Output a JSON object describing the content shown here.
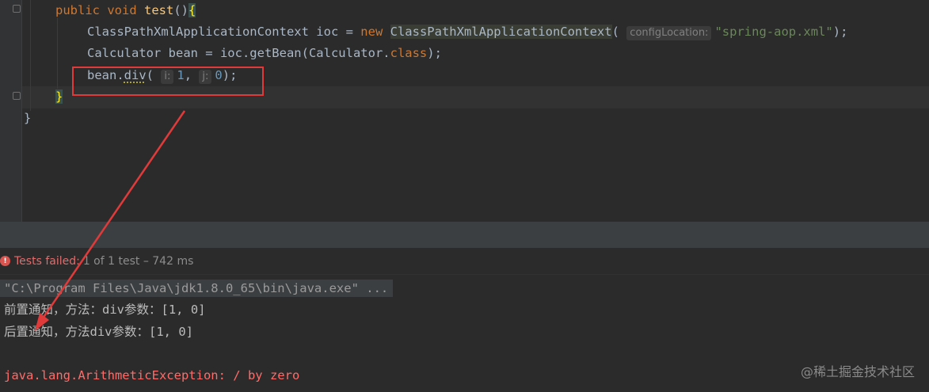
{
  "editor": {
    "line1": {
      "kw1": "public",
      "kw2": "void",
      "fn": "test",
      "rest": "()",
      "brace": "{"
    },
    "line2": {
      "type": "ClassPathXmlApplicationContext",
      "var": " ioc = ",
      "kw": "new",
      "cls": "ClassPathXmlApplicationContext",
      "open": "(",
      "hint": "configLocation:",
      "str": "\"spring-aop.xml\"",
      "close": ");"
    },
    "line3": {
      "pre": "Calculator bean = ioc.getBean(Calculator.",
      "kw": "class",
      "post": ");"
    },
    "line4": {
      "pre": "bean.",
      "method": "div",
      "open": "(",
      "hint1": "i:",
      "arg1": "1",
      "comma": ",",
      "hint2": "j:",
      "arg2": "0",
      "close": ");"
    },
    "line5": {
      "brace": "}"
    },
    "line6": {
      "brace": "}"
    }
  },
  "status": {
    "failed_label": "Tests failed:",
    "rest": "1 of 1 test – 742 ms",
    "icon": "error-icon"
  },
  "console": {
    "cmd": "\"C:\\Program Files\\Java\\jdk1.8.0_65\\bin\\java.exe\" ...",
    "before_advice": "前置通知，方法：div参数：[1, 0]",
    "after_advice": "后置通知，方法div参数：[1, 0]",
    "exception": "java.lang.ArithmeticException: / by zero"
  },
  "watermark": "@稀土掘金技术社区",
  "colors": {
    "annotation_red": "#e03a3a",
    "keyword": "#cc7832",
    "string": "#6a8759",
    "number": "#6897bb",
    "error_text": "#ff6b68"
  }
}
